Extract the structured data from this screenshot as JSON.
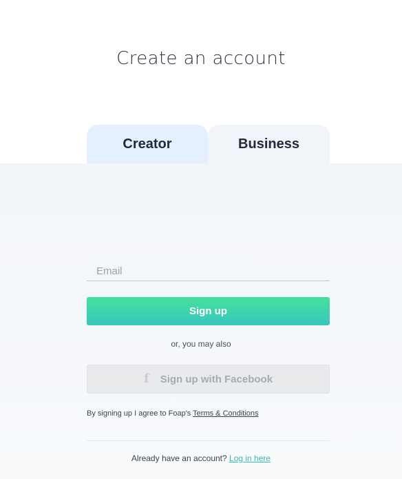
{
  "page": {
    "title": "Create an account"
  },
  "tabs": [
    {
      "label": "Creator",
      "active": true
    },
    {
      "label": "Business",
      "active": false
    }
  ],
  "form": {
    "email": {
      "placeholder": "Email",
      "value": ""
    },
    "signup_label": "Sign up",
    "or_text": "or, you may also",
    "facebook_label": "Sign up with Facebook",
    "facebook_icon": "facebook-f-icon"
  },
  "terms": {
    "prefix": "By signing up I agree to Foap's ",
    "link": "Terms & Conditions"
  },
  "login": {
    "prefix": "Already have an account? ",
    "link": "Log in here"
  },
  "colors": {
    "accent_start": "#45e199",
    "accent_end": "#39c6bf",
    "link": "#3ab8b3",
    "active_tab": "#e4f0fd",
    "inactive_tab": "#f1f4f8"
  }
}
